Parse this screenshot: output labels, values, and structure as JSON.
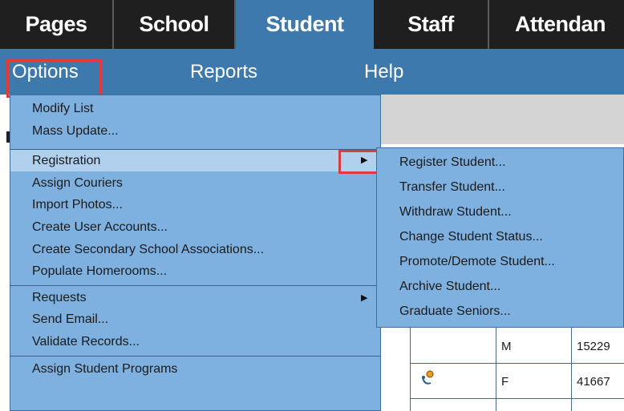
{
  "tabs": [
    {
      "label": "Pages",
      "active": false
    },
    {
      "label": "School",
      "active": false
    },
    {
      "label": "Student",
      "active": true
    },
    {
      "label": "Staff",
      "active": false
    },
    {
      "label": "Attendan",
      "active": false
    }
  ],
  "menubar": {
    "options": "Options",
    "reports": "Reports",
    "help": "Help"
  },
  "options_menu": {
    "items": [
      "Modify List",
      "Mass Update...",
      "Registration",
      "Assign Couriers",
      "Import Photos...",
      "Create User Accounts...",
      "Create Secondary School Associations...",
      "Populate Homerooms...",
      "Requests",
      "Send Email...",
      "Validate Records...",
      "Assign Student Programs"
    ]
  },
  "registration_submenu": {
    "items": [
      "Register Student...",
      "Transfer Student...",
      "Withdraw Student...",
      "Change Student Status...",
      "Promote/Demote Student...",
      "Archive Student...",
      "Graduate Seniors..."
    ]
  },
  "background_table": {
    "rows": [
      {
        "gender": "M",
        "id": "15229"
      },
      {
        "gender": "F",
        "id": "41667"
      }
    ]
  },
  "colors": {
    "tabbar": "#1f1f1f",
    "accent": "#3e79ad",
    "menu": "#7eb1e0",
    "highlight_box": "#e03a3a"
  }
}
